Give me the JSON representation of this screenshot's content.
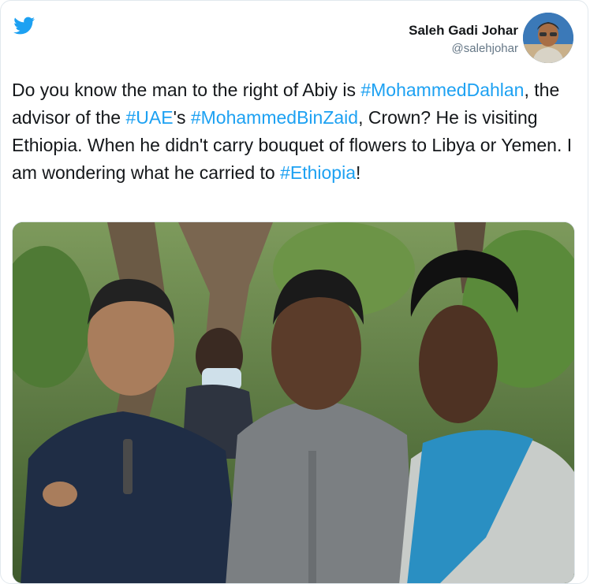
{
  "author": {
    "name": "Saleh Gadi Johar",
    "handle": "@salehjohar"
  },
  "tweet": {
    "segments": [
      {
        "text": "Do you know the man to the right of Abiy is ",
        "type": "text"
      },
      {
        "text": "#MohammedDahlan",
        "type": "hashtag"
      },
      {
        "text": ", the advisor of the ",
        "type": "text"
      },
      {
        "text": "#UAE",
        "type": "hashtag"
      },
      {
        "text": "'s ",
        "type": "text"
      },
      {
        "text": "#MohammedBinZaid",
        "type": "hashtag"
      },
      {
        "text": ", Crown? He is visiting Ethiopia. When he didn't carry bouquet of flowers to Libya or Yemen. I am wondering what he carried to ",
        "type": "text"
      },
      {
        "text": "#Ethiopia",
        "type": "hashtag"
      },
      {
        "text": "!",
        "type": "text"
      }
    ]
  },
  "icons": {
    "logo": "twitter-bird-icon"
  },
  "colors": {
    "brand": "#1da1f2",
    "text": "#14171a",
    "secondary": "#657786"
  }
}
